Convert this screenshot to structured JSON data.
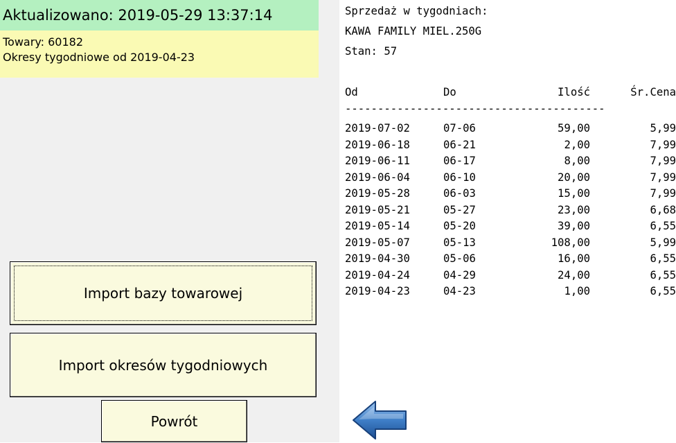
{
  "status": {
    "updated": "Aktualizowano: 2019-05-29 13:37:14",
    "goods": "Towary: 60182",
    "periods": "Okresy tygodniowe od 2019-04-23"
  },
  "buttons": {
    "import_base": "Import bazy towarowej",
    "import_weeks": "Import okresów tygodniowych",
    "back": "Powrót"
  },
  "report": {
    "heading": "Sprzedaż w tygodniach:",
    "product": "KAWA FAMILY MIEL.250G",
    "stock": "Stan: 57",
    "columns": {
      "from": "Od",
      "to": "Do",
      "qty": "Ilość",
      "avg_price": "Śr.Cena"
    },
    "separator": "----------------------------------------",
    "rows": [
      {
        "from": "2019-07-02",
        "to": "07-06",
        "qty": "59,00",
        "price": "5,99"
      },
      {
        "from": "2019-06-18",
        "to": "06-21",
        "qty": "2,00",
        "price": "7,99"
      },
      {
        "from": "2019-06-11",
        "to": "06-17",
        "qty": "8,00",
        "price": "7,99"
      },
      {
        "from": "2019-06-04",
        "to": "06-10",
        "qty": "20,00",
        "price": "7,99"
      },
      {
        "from": "2019-05-28",
        "to": "06-03",
        "qty": "15,00",
        "price": "7,99"
      },
      {
        "from": "2019-05-21",
        "to": "05-27",
        "qty": "23,00",
        "price": "6,68"
      },
      {
        "from": "2019-05-14",
        "to": "05-20",
        "qty": "39,00",
        "price": "6,55"
      },
      {
        "from": "2019-05-07",
        "to": "05-13",
        "qty": "108,00",
        "price": "5,99"
      },
      {
        "from": "2019-04-30",
        "to": "05-06",
        "qty": "16,00",
        "price": "6,55"
      },
      {
        "from": "2019-04-24",
        "to": "04-29",
        "qty": "24,00",
        "price": "6,55"
      },
      {
        "from": "2019-04-23",
        "to": "04-23",
        "qty": "1,00",
        "price": "6,55"
      }
    ]
  },
  "icons": {
    "back_arrow": "left-arrow-icon"
  },
  "colors": {
    "status_green": "#b4f0c0",
    "info_yellow": "#fafab4",
    "button_bg": "#fafade",
    "arrow_blue": "#2f6fb8"
  }
}
